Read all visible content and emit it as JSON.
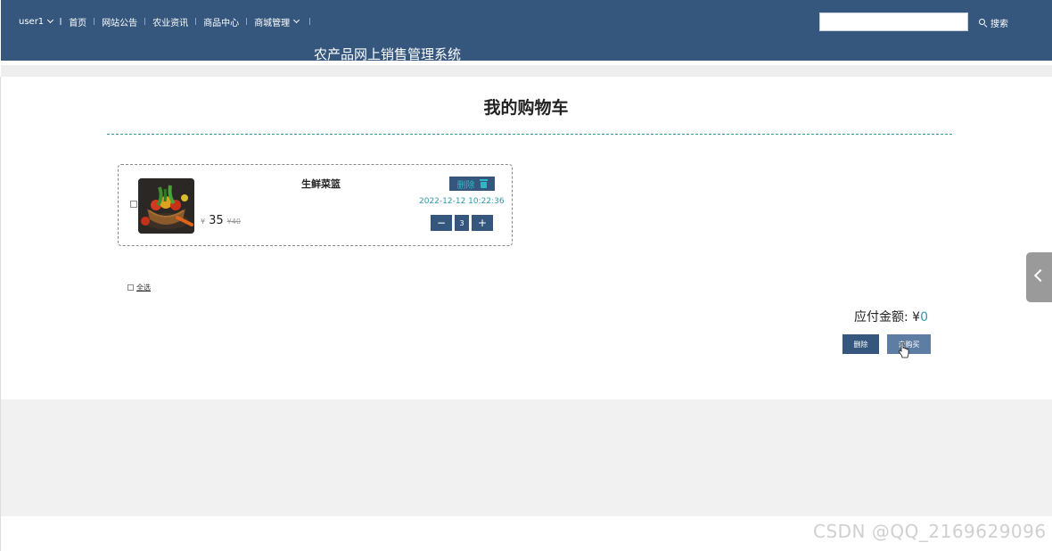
{
  "header": {
    "user_menu": "user1",
    "nav": [
      "首页",
      "网站公告",
      "农业资讯",
      "商品中心",
      "商城管理"
    ],
    "search_placeholder": "",
    "search_button": "搜索",
    "site_title": "农产品网上销售管理系统"
  },
  "cart": {
    "heading": "我的购物车",
    "items": [
      {
        "name": "生鲜菜篮",
        "currency": "¥",
        "price": "35",
        "original_price": "¥40",
        "delete_label": "删除",
        "date": "2022-12-12 10:22:36",
        "quantity": "3",
        "minus": "−",
        "plus": "+"
      }
    ],
    "select_all": "全选",
    "total_label": "应付金额: ¥",
    "total_value": "0",
    "delete_button": "删除",
    "buy_button": "去购买"
  },
  "watermark": "CSDN @QQ_2169629096",
  "colors": {
    "header_bg": "#35577e",
    "accent": "#2e9aa8",
    "side_tab": "#9a9a9a"
  },
  "icons": {
    "search": "search-icon",
    "trash": "trash-icon",
    "side_tab": "chevron-left-icon"
  }
}
